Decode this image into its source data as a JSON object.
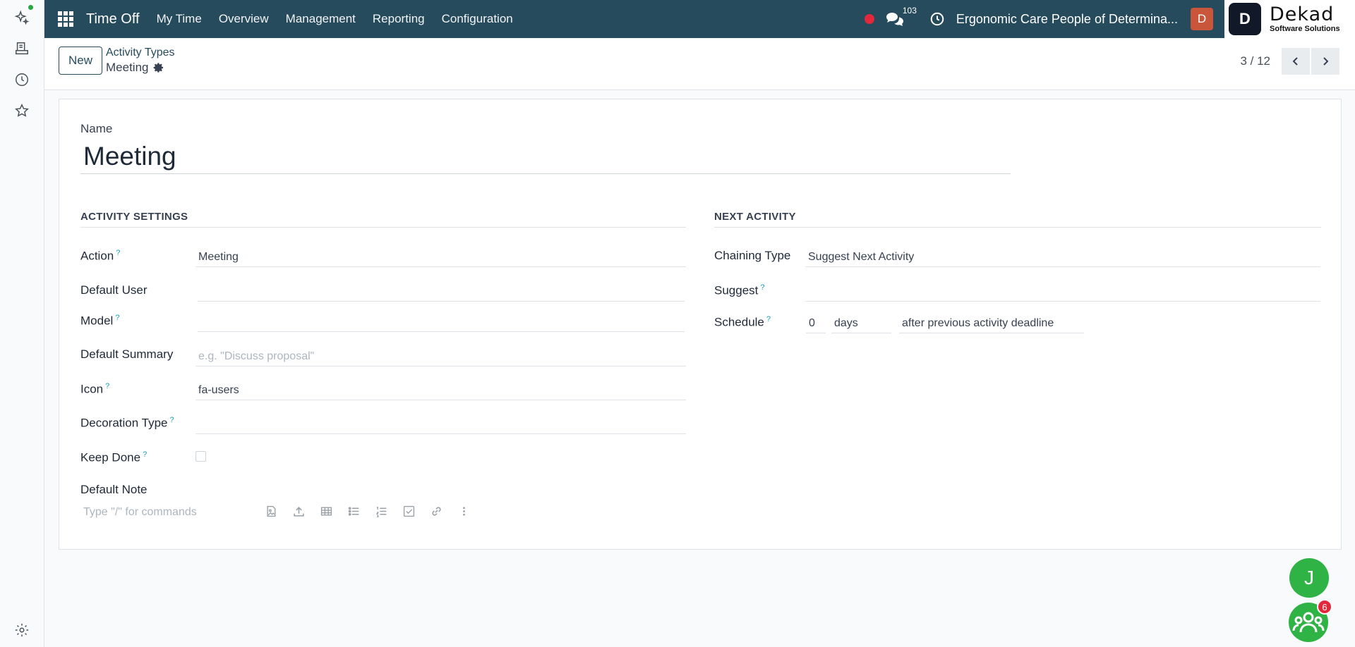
{
  "navbar": {
    "app_name": "Time Off",
    "menu": [
      "My Time",
      "Overview",
      "Management",
      "Reporting",
      "Configuration"
    ],
    "message_count": "103",
    "company": "Ergonomic Care People of Determina...",
    "user_initial": "D",
    "colors": {
      "bar": "#264b5d",
      "record_dot": "#e3283c",
      "avatar": "#c9563a"
    }
  },
  "logo": {
    "mark": "D",
    "name": "Dekad",
    "tagline": "Software Solutions"
  },
  "rail": {
    "icons": [
      "ai-sparkle-icon",
      "inbox-tray-icon",
      "clock-icon",
      "star-icon",
      "gear-icon"
    ]
  },
  "control_panel": {
    "new_label": "New",
    "breadcrumb_parent": "Activity Types",
    "breadcrumb_current": "Meeting",
    "pager": "3 / 12"
  },
  "form": {
    "name_label": "Name",
    "name_value": "Meeting",
    "activity_settings": {
      "title": "ACTIVITY SETTINGS",
      "action": {
        "label": "Action",
        "value": "Meeting"
      },
      "default_user": {
        "label": "Default User",
        "value": ""
      },
      "model": {
        "label": "Model",
        "value": ""
      },
      "default_summary": {
        "label": "Default Summary",
        "placeholder": "e.g. \"Discuss proposal\""
      },
      "icon": {
        "label": "Icon",
        "value": "fa-users"
      },
      "decoration_type": {
        "label": "Decoration Type",
        "value": ""
      },
      "keep_done": {
        "label": "Keep Done",
        "checked": false
      },
      "default_note": {
        "label": "Default Note",
        "placeholder": "Type \"/\" for commands"
      }
    },
    "next_activity": {
      "title": "NEXT ACTIVITY",
      "chaining_type": {
        "label": "Chaining Type",
        "value": "Suggest Next Activity"
      },
      "suggest": {
        "label": "Suggest",
        "value": ""
      },
      "schedule": {
        "label": "Schedule",
        "amount": "0",
        "unit": "days",
        "relative": "after previous activity deadline"
      }
    },
    "help_mark": "?"
  },
  "floating": {
    "chat_initial": "J",
    "group_badge": "6",
    "color": "#2fb344"
  }
}
